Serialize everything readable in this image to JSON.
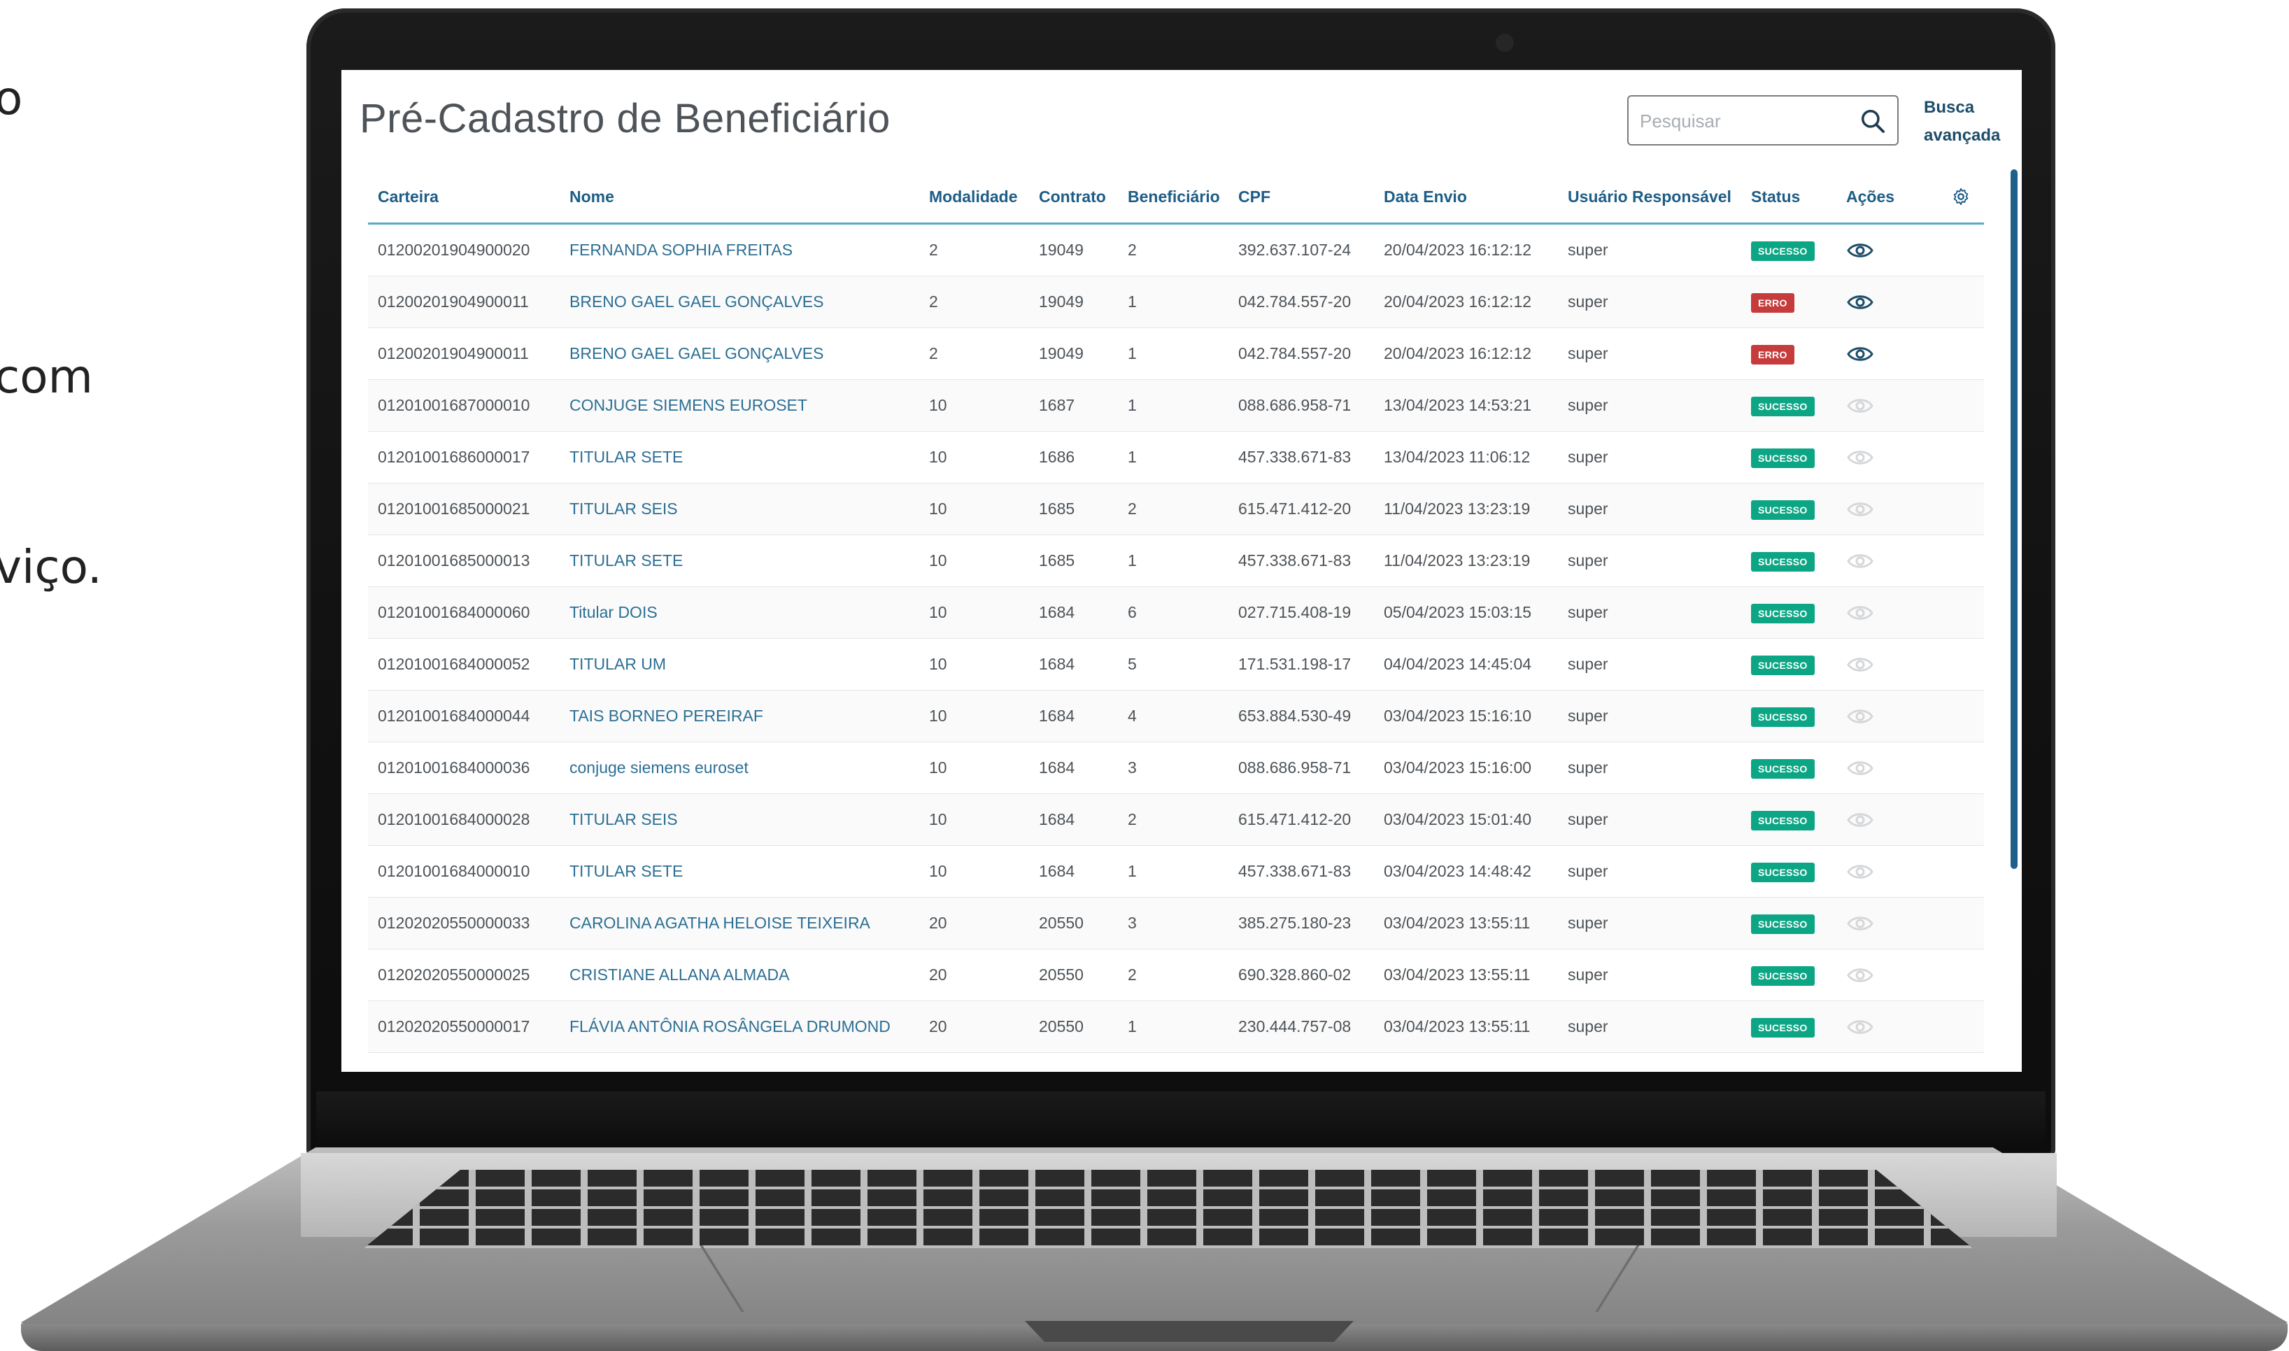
{
  "side_text": [
    "o",
    "com",
    "viço."
  ],
  "page": {
    "title": "Pré-Cadastro de Beneficiário",
    "search_placeholder": "Pesquisar",
    "advanced_search": [
      "Busca",
      "avançada"
    ]
  },
  "table": {
    "headers": [
      "Carteira",
      "Nome",
      "Modalidade",
      "Contrato",
      "Beneficiário",
      "CPF",
      "Data Envio",
      "Usuário Responsável",
      "Status",
      "Ações"
    ],
    "rows": [
      {
        "carteira": "01200201904900020",
        "nome": "FERNANDA SOPHIA FREITAS",
        "modalidade": "2",
        "contrato": "19049",
        "beneficiario": "2",
        "cpf": "392.637.107-24",
        "data": "20/04/2023 16:12:12",
        "usuario": "super",
        "status": "SUCESSO",
        "status_type": "ok",
        "eye_active": true
      },
      {
        "carteira": "01200201904900011",
        "nome": "BRENO GAEL GAEL GONÇALVES",
        "modalidade": "2",
        "contrato": "19049",
        "beneficiario": "1",
        "cpf": "042.784.557-20",
        "data": "20/04/2023 16:12:12",
        "usuario": "super",
        "status": "ERRO",
        "status_type": "err",
        "eye_active": true
      },
      {
        "carteira": "01200201904900011",
        "nome": "BRENO GAEL GAEL GONÇALVES",
        "modalidade": "2",
        "contrato": "19049",
        "beneficiario": "1",
        "cpf": "042.784.557-20",
        "data": "20/04/2023 16:12:12",
        "usuario": "super",
        "status": "ERRO",
        "status_type": "err",
        "eye_active": true
      },
      {
        "carteira": "01201001687000010",
        "nome": "CONJUGE SIEMENS EUROSET",
        "modalidade": "10",
        "contrato": "1687",
        "beneficiario": "1",
        "cpf": "088.686.958-71",
        "data": "13/04/2023 14:53:21",
        "usuario": "super",
        "status": "SUCESSO",
        "status_type": "ok",
        "eye_active": false
      },
      {
        "carteira": "01201001686000017",
        "nome": "TITULAR SETE",
        "modalidade": "10",
        "contrato": "1686",
        "beneficiario": "1",
        "cpf": "457.338.671-83",
        "data": "13/04/2023 11:06:12",
        "usuario": "super",
        "status": "SUCESSO",
        "status_type": "ok",
        "eye_active": false
      },
      {
        "carteira": "01201001685000021",
        "nome": "TITULAR SEIS",
        "modalidade": "10",
        "contrato": "1685",
        "beneficiario": "2",
        "cpf": "615.471.412-20",
        "data": "11/04/2023 13:23:19",
        "usuario": "super",
        "status": "SUCESSO",
        "status_type": "ok",
        "eye_active": false
      },
      {
        "carteira": "01201001685000013",
        "nome": "TITULAR SETE",
        "modalidade": "10",
        "contrato": "1685",
        "beneficiario": "1",
        "cpf": "457.338.671-83",
        "data": "11/04/2023 13:23:19",
        "usuario": "super",
        "status": "SUCESSO",
        "status_type": "ok",
        "eye_active": false
      },
      {
        "carteira": "01201001684000060",
        "nome": "Titular DOIS",
        "modalidade": "10",
        "contrato": "1684",
        "beneficiario": "6",
        "cpf": "027.715.408-19",
        "data": "05/04/2023 15:03:15",
        "usuario": "super",
        "status": "SUCESSO",
        "status_type": "ok",
        "eye_active": false
      },
      {
        "carteira": "01201001684000052",
        "nome": "TITULAR UM",
        "modalidade": "10",
        "contrato": "1684",
        "beneficiario": "5",
        "cpf": "171.531.198-17",
        "data": "04/04/2023 14:45:04",
        "usuario": "super",
        "status": "SUCESSO",
        "status_type": "ok",
        "eye_active": false
      },
      {
        "carteira": "01201001684000044",
        "nome": "TAIS BORNEO PEREIRAF",
        "modalidade": "10",
        "contrato": "1684",
        "beneficiario": "4",
        "cpf": "653.884.530-49",
        "data": "03/04/2023 15:16:10",
        "usuario": "super",
        "status": "SUCESSO",
        "status_type": "ok",
        "eye_active": false
      },
      {
        "carteira": "01201001684000036",
        "nome": "conjuge siemens euroset",
        "modalidade": "10",
        "contrato": "1684",
        "beneficiario": "3",
        "cpf": "088.686.958-71",
        "data": "03/04/2023 15:16:00",
        "usuario": "super",
        "status": "SUCESSO",
        "status_type": "ok",
        "eye_active": false
      },
      {
        "carteira": "01201001684000028",
        "nome": "TITULAR SEIS",
        "modalidade": "10",
        "contrato": "1684",
        "beneficiario": "2",
        "cpf": "615.471.412-20",
        "data": "03/04/2023 15:01:40",
        "usuario": "super",
        "status": "SUCESSO",
        "status_type": "ok",
        "eye_active": false
      },
      {
        "carteira": "01201001684000010",
        "nome": "TITULAR SETE",
        "modalidade": "10",
        "contrato": "1684",
        "beneficiario": "1",
        "cpf": "457.338.671-83",
        "data": "03/04/2023 14:48:42",
        "usuario": "super",
        "status": "SUCESSO",
        "status_type": "ok",
        "eye_active": false
      },
      {
        "carteira": "01202020550000033",
        "nome": "CAROLINA AGATHA HELOISE TEIXEIRA",
        "modalidade": "20",
        "contrato": "20550",
        "beneficiario": "3",
        "cpf": "385.275.180-23",
        "data": "03/04/2023 13:55:11",
        "usuario": "super",
        "status": "SUCESSO",
        "status_type": "ok",
        "eye_active": false
      },
      {
        "carteira": "01202020550000025",
        "nome": "CRISTIANE ALLANA ALMADA",
        "modalidade": "20",
        "contrato": "20550",
        "beneficiario": "2",
        "cpf": "690.328.860-02",
        "data": "03/04/2023 13:55:11",
        "usuario": "super",
        "status": "SUCESSO",
        "status_type": "ok",
        "eye_active": false
      },
      {
        "carteira": "01202020550000017",
        "nome": "FLÁVIA ANTÔNIA ROSÂNGELA DRUMOND",
        "modalidade": "20",
        "contrato": "20550",
        "beneficiario": "1",
        "cpf": "230.444.757-08",
        "data": "03/04/2023 13:55:11",
        "usuario": "super",
        "status": "SUCESSO",
        "status_type": "ok",
        "eye_active": false
      }
    ]
  },
  "icons": {
    "search": "search-icon",
    "eye": "eye-icon",
    "settings": "gear-icon"
  },
  "colors": {
    "header_text": "#1d5d86",
    "header_rule": "#56a9d0",
    "name_link": "#2c6f94",
    "success": "#0ca685",
    "error": "#c63b3b",
    "eye_active": "#1d4d69",
    "eye_inactive": "#d5d7d9"
  }
}
